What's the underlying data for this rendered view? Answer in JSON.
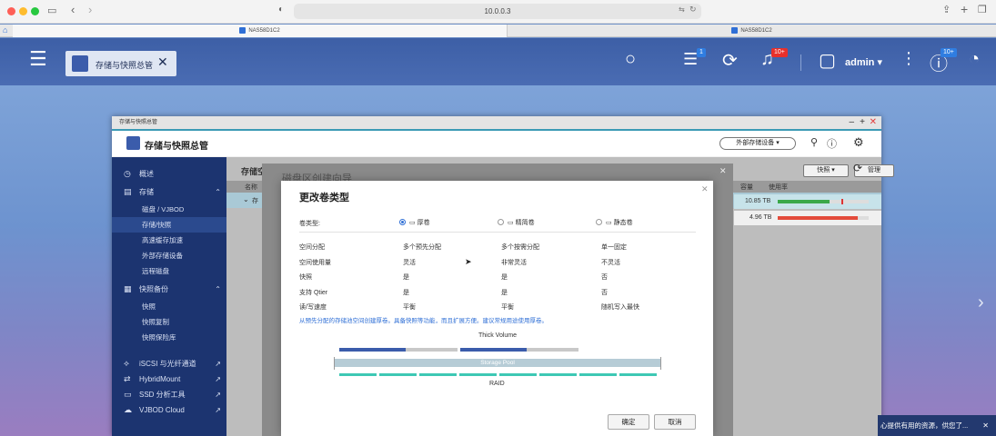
{
  "browser": {
    "url": "10.0.0.3",
    "tabs": [
      {
        "label": "NAS58D1C2",
        "active": true
      },
      {
        "label": "NAS58D1C2",
        "active": false
      }
    ]
  },
  "topbar": {
    "app_tab_label": "存储与快照总管",
    "user": "admin ▾",
    "badge_tasks": "1",
    "badge_notifications": "10+",
    "badge_info": "10+"
  },
  "window": {
    "title_small": "存储与快照总管",
    "title": "存储与快照总管",
    "external_storage_btn": "外部存储设备 ▾",
    "header_partial": "存储空",
    "toolbar": {
      "snapshot": "快照 ▾",
      "manage": "管理"
    },
    "table_headers": {
      "name_partial": "名称",
      "capacity": "容量",
      "usage": "使用率"
    },
    "rows": [
      {
        "prefix": "存",
        "capacity": "10.85 TB",
        "used_pct": 57
      },
      {
        "prefix": "",
        "capacity": "4.96 TB",
        "used_pct": 88
      }
    ]
  },
  "sidebar": {
    "overview": "概述",
    "storage": "存储",
    "storage_items": [
      "磁盘 / VJBOD",
      "存储/快照",
      "高速缓存加速",
      "外部存储设备",
      "远程磁盘"
    ],
    "snapshot_backup": "快照备份",
    "snapshot_items": [
      "快照",
      "快照复制",
      "快照保险库"
    ],
    "links": [
      "iSCSI 与光纤通道",
      "HybridMount",
      "SSD 分析工具",
      "VJBOD Cloud"
    ]
  },
  "wizard": {
    "title": "磁盘区创建向导"
  },
  "dialog": {
    "title": "更改卷类型",
    "volume_type_label": "卷类型:",
    "options": [
      "厚卷",
      "精简卷",
      "静态卷"
    ],
    "rows": [
      [
        "空间分配",
        "多个预先分配",
        "多个按需分配",
        "单一固定"
      ],
      [
        "空间使用量",
        "灵活",
        "非常灵活",
        "不灵活"
      ],
      [
        "快照",
        "是",
        "是",
        "否"
      ],
      [
        "支持 Qtier",
        "是",
        "是",
        "否"
      ],
      [
        "读/写速度",
        "平衡",
        "平衡",
        "随机写入最快"
      ]
    ],
    "hint": "从预先分配的存储池空间创建厚卷。具备快照等功能，而且扩展方便。建议常规用途使用厚卷。",
    "diagram": {
      "top": "Thick Volume",
      "middle": "Storage Pool",
      "bottom": "RAID"
    },
    "ok": "确定",
    "cancel": "取消"
  },
  "toast": {
    "text": "心提供有用的资源，供您了..."
  },
  "colors": {
    "accent": "#2f6fd6",
    "sidebar": "#1c3470",
    "topbar": "#3d5fa6",
    "raid": "#3ec8b4",
    "volume": "#3b5cab"
  }
}
